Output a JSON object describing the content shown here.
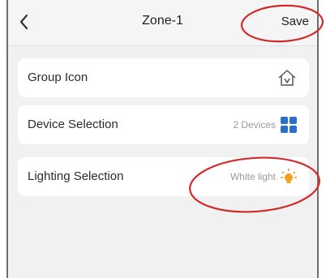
{
  "header": {
    "title": "Zone-1",
    "save_label": "Save"
  },
  "rows": [
    {
      "label": "Group Icon",
      "icon": "home-icon"
    },
    {
      "label": "Device Selection",
      "value": "2 Devices",
      "icon": "grid-icon",
      "icon_color": "#2c6fc9"
    },
    {
      "label": "Lighting Selection",
      "value": "White light",
      "icon": "light-icon",
      "icon_color": "#f0a020"
    }
  ],
  "annotations": {
    "circle_color": "#d22a2a"
  }
}
